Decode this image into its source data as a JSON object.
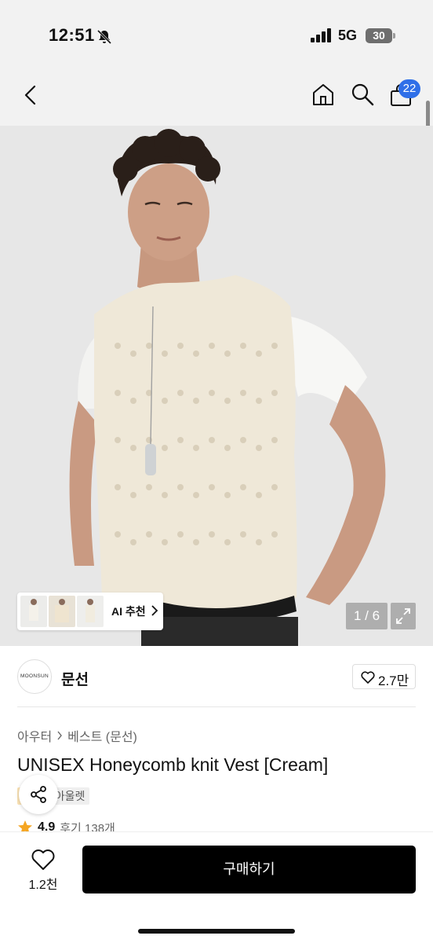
{
  "status_bar": {
    "time": "12:51",
    "network": "5G",
    "battery": "30",
    "icons": [
      "bell-off-icon",
      "signal-icon"
    ]
  },
  "nav": {
    "icons": [
      "back-icon",
      "home-icon",
      "search-icon",
      "shopping-bag-icon"
    ],
    "cart_count": "22"
  },
  "gallery": {
    "ai_recommend_label": "AI 추천",
    "page_indicator": "1 / 6",
    "expand_icon": "expand-icon"
  },
  "brand": {
    "logo_text": "MOONSUN",
    "name": "문선",
    "likes": "2.7만"
  },
  "product": {
    "breadcrumb": [
      "아우터",
      "베스트 (문선)"
    ],
    "title": "UNISEX Honeycomb knit Vest [Cream]",
    "tags": [
      "세일",
      "아울렛"
    ],
    "rating": "4.9",
    "review_count": "후기 138개"
  },
  "bottom_bar": {
    "wish_count": "1.2천",
    "buy_label": "구매하기"
  },
  "colors": {
    "accent_badge": "#2f6fe8",
    "buy_button": "#000000",
    "star": "#f5a623",
    "sale_tag_bg": "#fbe3b5"
  }
}
